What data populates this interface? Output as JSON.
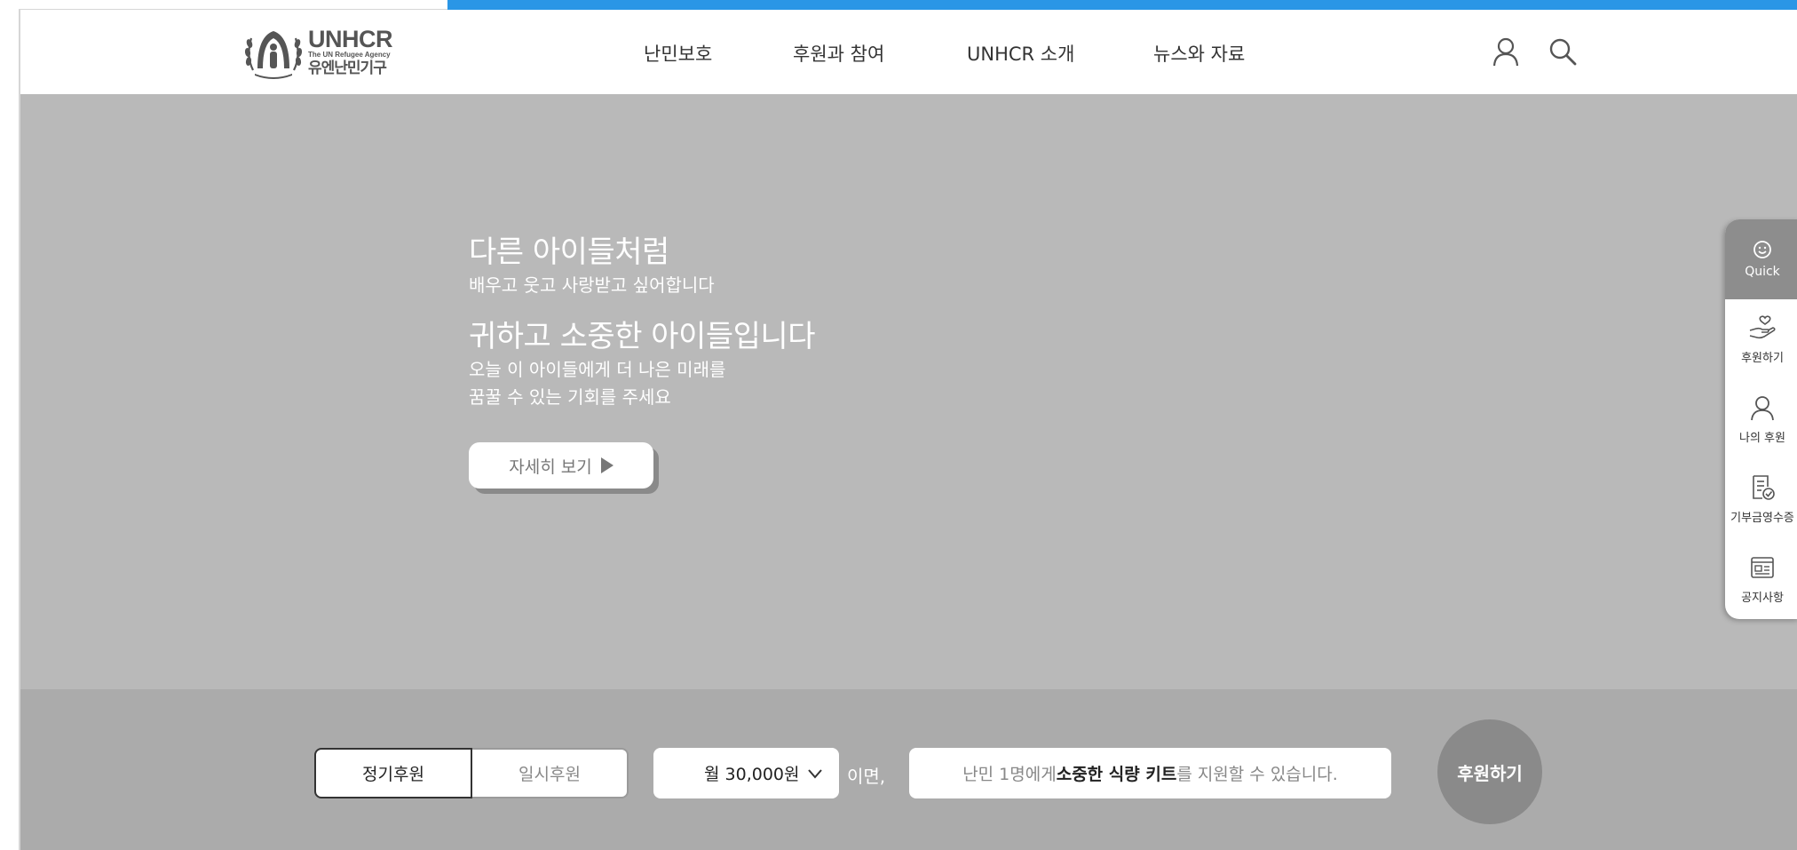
{
  "brand": {
    "logo_title": "UNHCR",
    "logo_sub": "The UN Refugee Agency",
    "logo_kr": "유엔난민기구",
    "accent_color": "#2a96e6"
  },
  "nav": {
    "items": [
      "난민보호",
      "후원과 참여",
      "UNHCR 소개",
      "뉴스와 자료"
    ]
  },
  "header_icons": [
    "user-icon",
    "search-icon"
  ],
  "hero": {
    "heading1": "다른 아이들처럼",
    "line1": "배우고 웃고 사랑받고 싶어합니다",
    "heading2": "귀하고 소중한 아이들입니다",
    "line2": "오늘 이 아이들에게 더 나은 미래를",
    "line3": "꿈꿀 수 있는 기회를 주세요",
    "more_label": "자세히 보기"
  },
  "donate": {
    "type_regular": "정기후원",
    "type_once": "일시후원",
    "amount": "월 30,000원",
    "suffix": "이면,",
    "info_pre": "난민 1명에게 ",
    "info_bold": "소중한 식량 키트",
    "info_post": "를 지원할 수 있습니다.",
    "button": "후원하기"
  },
  "quick_menu": {
    "head": "Quick",
    "items": [
      {
        "label": "후원하기",
        "icon": "heart-hand-icon"
      },
      {
        "label": "나의 후원",
        "icon": "user-icon"
      },
      {
        "label": "기부금영수증",
        "icon": "receipt-icon"
      },
      {
        "label": "공지사항",
        "icon": "news-icon"
      }
    ]
  }
}
